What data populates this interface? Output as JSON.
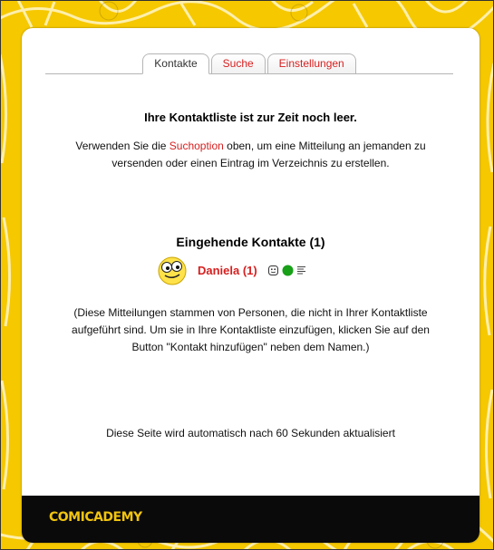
{
  "tabs": [
    {
      "label": "Kontakte",
      "active": true
    },
    {
      "label": "Suche",
      "active": false
    },
    {
      "label": "Einstellungen",
      "active": false
    }
  ],
  "empty_heading": "Ihre Kontaktliste ist zur Zeit noch leer.",
  "intro": {
    "before": "Verwenden Sie die ",
    "link": "Suchoption",
    "after": " oben, um eine Mitteilung an jemanden zu versenden oder einen Eintrag im Verzeichnis zu erstellen."
  },
  "incoming_heading": "Eingehende Kontakte (1)",
  "contact": {
    "name": "Daniela (1)",
    "icons": [
      "smiley-face-icon",
      "online-status-icon",
      "details-list-icon"
    ],
    "status_color": "#18a018"
  },
  "incoming_note": "(Diese Mitteilungen stammen von Personen, die nicht in Ihrer Kontaktliste aufgeführt sind. Um sie in Ihre Kontaktliste einzufügen, klicken Sie auf den Button \"Kontakt hinzufügen\" neben dem Namen.)",
  "refresh_note": "Diese Seite wird automatisch nach 60 Sekunden aktualisiert",
  "footer": {
    "logo": "COMICADEMY"
  },
  "colors": {
    "accent": "#d62020",
    "background": "#f5c800",
    "footer": "#0a0a0a",
    "logo": "#f1c40f"
  }
}
